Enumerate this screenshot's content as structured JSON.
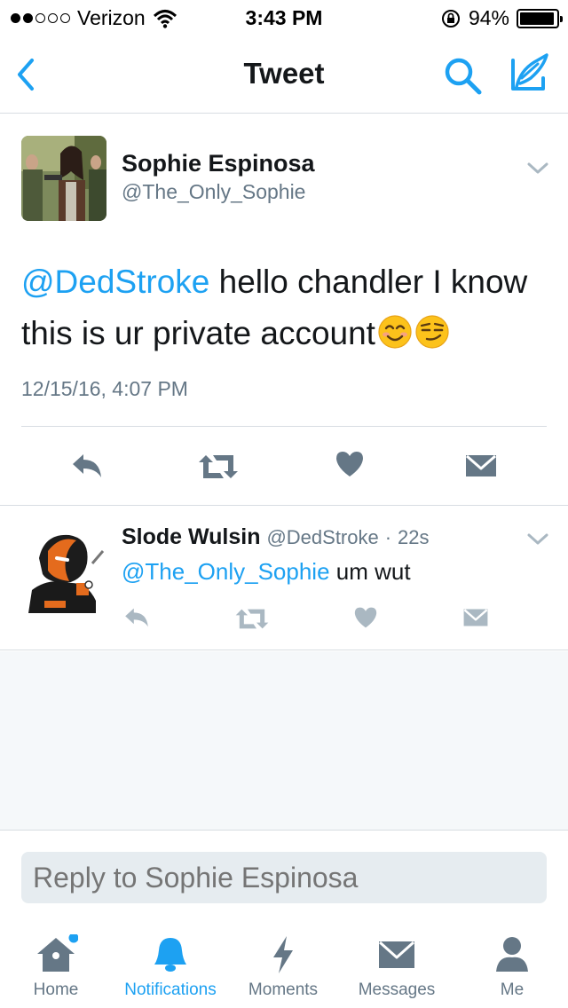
{
  "status_bar": {
    "carrier": "Verizon",
    "time": "3:43 PM",
    "battery": "94%",
    "battery_level": 0.94,
    "signal_bars_filled": 2,
    "signal_bars_total": 5
  },
  "nav": {
    "title": "Tweet",
    "back_icon": "chevron-left-icon",
    "search_icon": "search-icon",
    "compose_icon": "compose-icon",
    "accent_color": "#1da1f2"
  },
  "main_tweet": {
    "author_name": "Sophie Espinosa",
    "author_handle": "@The_Only_Sophie",
    "mention": "@DedStroke",
    "text": " hello chandler I know this is ur private account",
    "emojis": [
      "smiling-face-icon",
      "smirking-face-icon"
    ],
    "date": "12/15/16, 4:07 PM",
    "actions": [
      "reply-icon",
      "retweet-icon",
      "like-icon",
      "direct-message-icon"
    ]
  },
  "reply_tweet": {
    "author_name": "Slode Wulsin",
    "author_handle": "@DedStroke",
    "time_separator": "·",
    "age": "22s",
    "mention": "@The_Only_Sophie",
    "text": " um wut",
    "actions": [
      "reply-icon",
      "retweet-icon",
      "like-icon",
      "direct-message-icon"
    ]
  },
  "reply_box": {
    "placeholder": "Reply to Sophie Espinosa"
  },
  "tabs": [
    {
      "label": "Home",
      "icon": "home-icon",
      "active": false,
      "has_dot": true
    },
    {
      "label": "Notifications",
      "icon": "bell-icon",
      "active": true,
      "has_dot": false
    },
    {
      "label": "Moments",
      "icon": "lightning-icon",
      "active": false,
      "has_dot": false
    },
    {
      "label": "Messages",
      "icon": "envelope-icon",
      "active": false,
      "has_dot": false
    },
    {
      "label": "Me",
      "icon": "person-icon",
      "active": false,
      "has_dot": false
    }
  ]
}
